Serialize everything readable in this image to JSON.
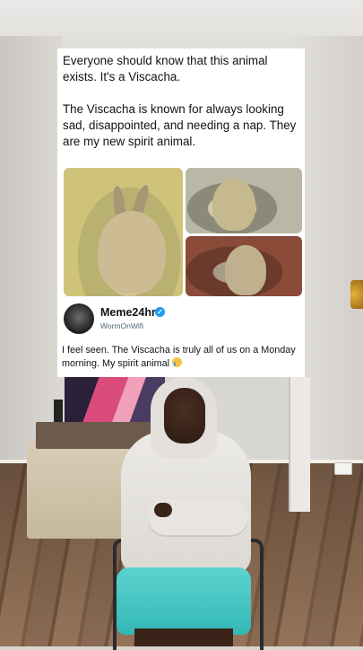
{
  "post": {
    "text": "Everyone should know that this animal exists. It's a Viscacha.\n\nThe Viscacha is known for always looking sad, disappointed, and needing a nap. They are my new spirit animal.",
    "images": [
      "viscacha-photo-main",
      "viscacha-photo-top-right",
      "viscacha-photo-bottom-right"
    ]
  },
  "reply": {
    "author_name": "Meme24hr",
    "author_handle": "WormOnWifi",
    "text": "I feel seen. The Viscacha is truly all of us on a Monday morning. My spirit animal "
  },
  "icons": {
    "verified": "verified-badge-icon",
    "emoji": "crying-face-emoji"
  },
  "colors": {
    "card": "#ffffff",
    "text": "#0f1419",
    "handle": "#536471",
    "verified": "#1d9bf0",
    "shorts": "#3fc4c2"
  }
}
